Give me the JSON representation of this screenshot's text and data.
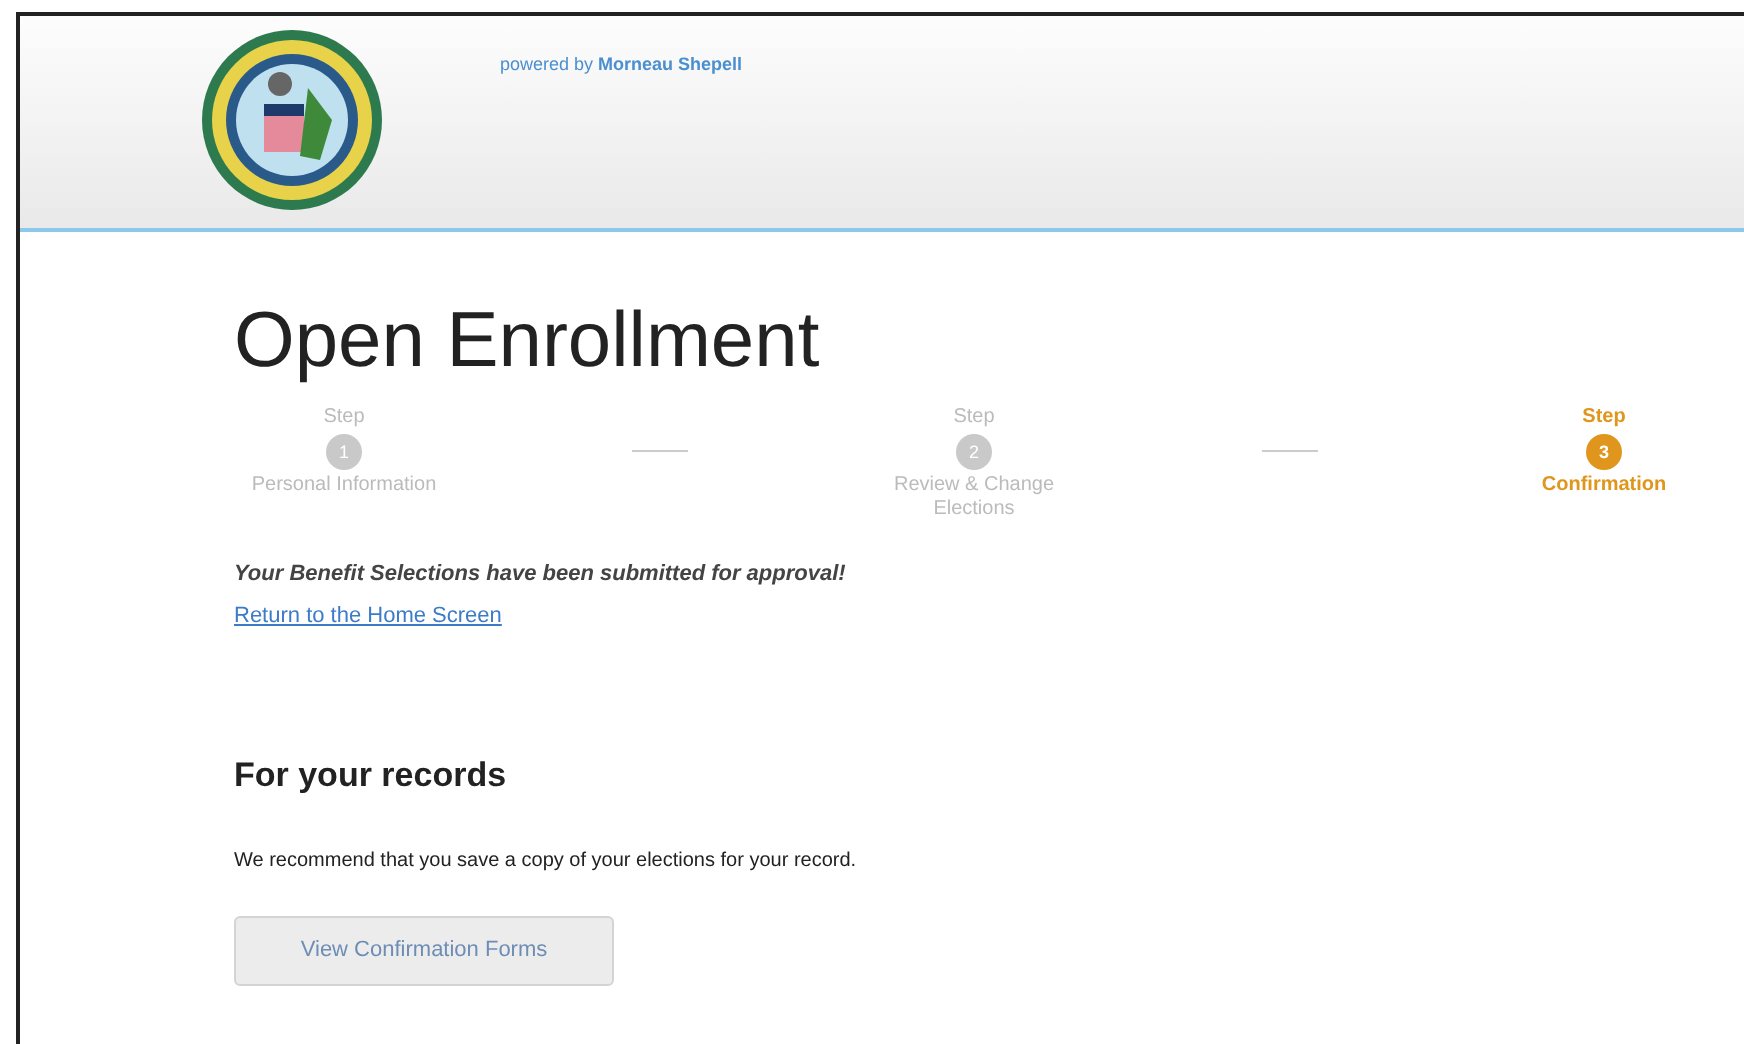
{
  "header": {
    "powered_by": "powered by **Morneau Shepell**"
  },
  "title": "Open Enrollment",
  "steps": [
    {
      "caption": "Step",
      "number": "1",
      "label": "Personal Information",
      "selected": false
    },
    {
      "caption": "Step",
      "number": "2",
      "label": "Review & Change Elections",
      "selected": false
    },
    {
      "caption": "Step",
      "number": "3",
      "label": "Confirmation",
      "selected": true
    }
  ],
  "message": "Your Benefit Selections have been submitted for approval!",
  "home_link": "Return to the Home Screen",
  "records": {
    "heading": "For your records",
    "text": "We recommend that you save a copy of your elections for your record.",
    "button": "View Confirmation Forms"
  }
}
